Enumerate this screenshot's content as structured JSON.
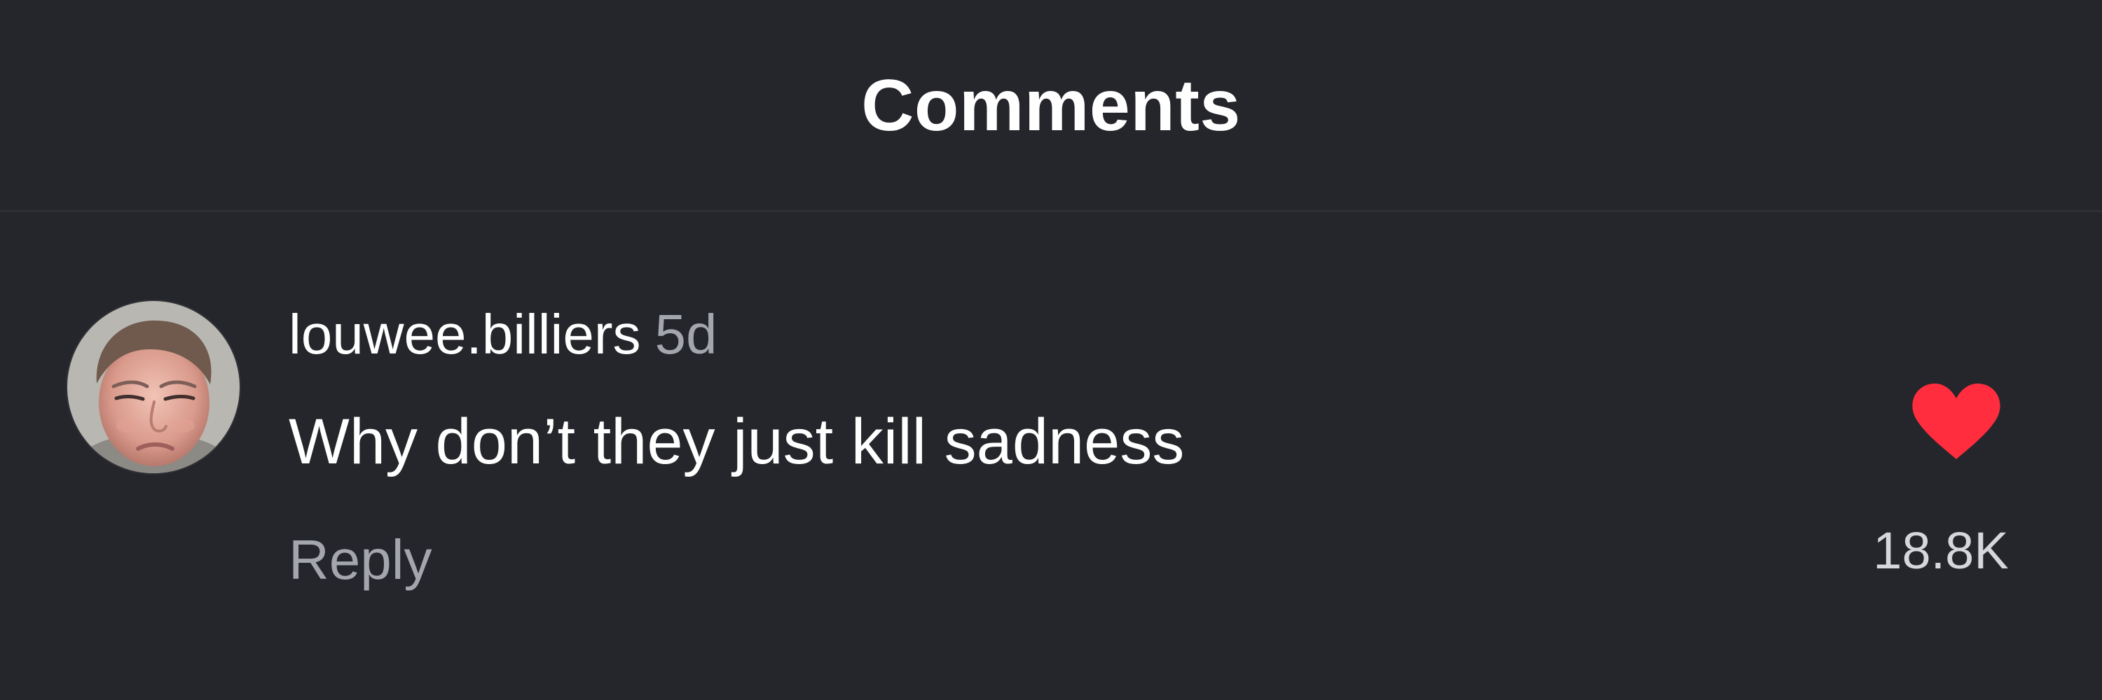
{
  "header": {
    "title": "Comments"
  },
  "comment": {
    "username": "louwee.billiers",
    "timestamp": "5d",
    "text": "Why don’t they just kill sadness",
    "reply_label": "Reply",
    "like_count": "18.8K",
    "liked": true,
    "avatar_icon": "user-avatar-photo",
    "heart_icon": "heart-filled-icon"
  },
  "colors": {
    "background": "#25262b",
    "text": "#ffffff",
    "muted_text": "#a4a6ad",
    "like_red": "#ff2d3d"
  }
}
